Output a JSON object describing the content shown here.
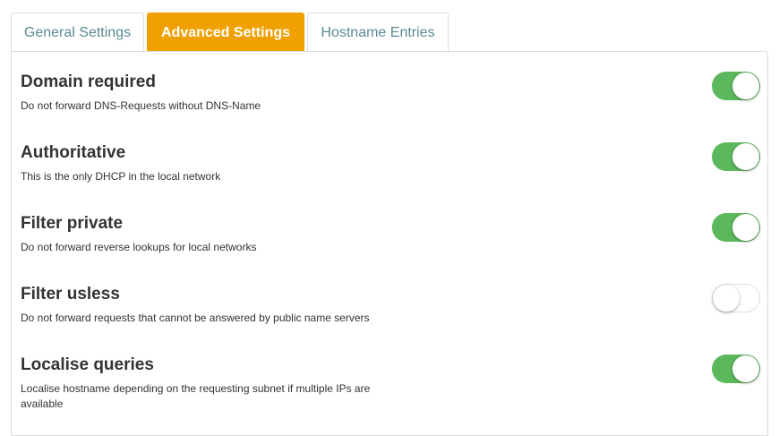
{
  "tabs": [
    {
      "label": "General Settings",
      "active": false
    },
    {
      "label": "Advanced Settings",
      "active": true
    },
    {
      "label": "Hostname Entries",
      "active": false
    }
  ],
  "settings": [
    {
      "title": "Domain required",
      "description": "Do not forward DNS-Requests without DNS-Name",
      "enabled": true
    },
    {
      "title": "Authoritative",
      "description": "This is the only DHCP in the local network",
      "enabled": true
    },
    {
      "title": "Filter private",
      "description": "Do not forward reverse lookups for local networks",
      "enabled": true
    },
    {
      "title": "Filter usless",
      "description": "Do not forward requests that cannot be answered by public name servers",
      "enabled": false
    },
    {
      "title": "Localise queries",
      "description": "Localise hostname depending on the requesting subnet if multiple IPs are available",
      "enabled": true
    }
  ],
  "colors": {
    "active_tab": "#f0a000",
    "toggle_on": "#5cb85c",
    "tab_text": "#5a8a94"
  }
}
